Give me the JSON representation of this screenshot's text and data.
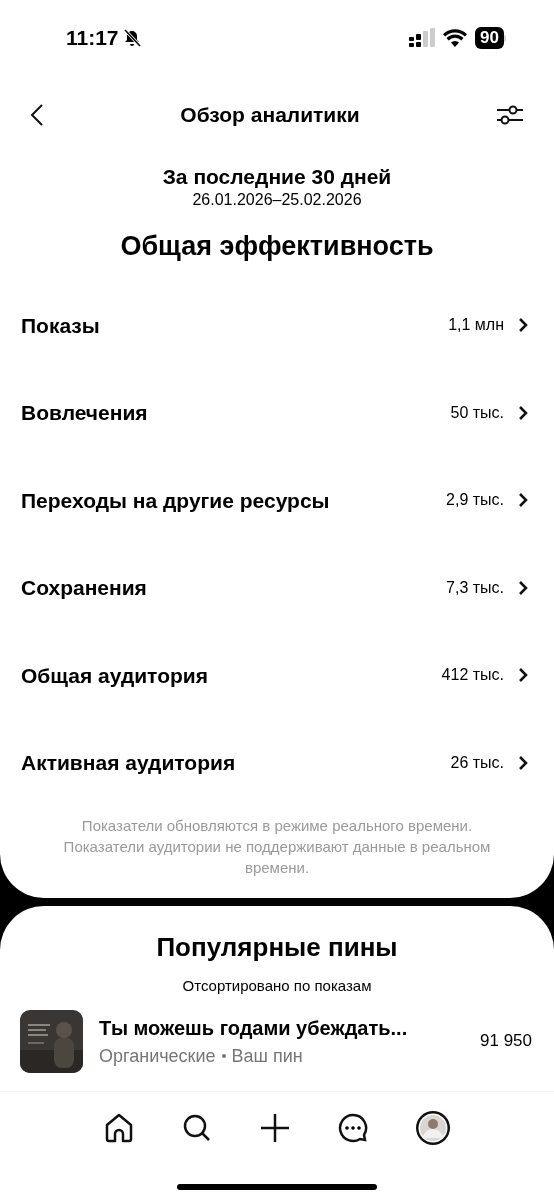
{
  "status_bar": {
    "time": "11:17",
    "silent": true,
    "battery": "90"
  },
  "header": {
    "title": "Обзор аналитики"
  },
  "period": {
    "title": "За последние 30 дней",
    "dates": "26.01.2026–25.02.2026"
  },
  "overall": {
    "title": "Общая эффективность",
    "metrics": [
      {
        "label": "Показы",
        "value": "1,1 млн"
      },
      {
        "label": "Вовлечения",
        "value": "50 тыс."
      },
      {
        "label": "Переходы на другие ресурсы",
        "value": "2,9 тыс."
      },
      {
        "label": "Сохранения",
        "value": "7,3 тыс."
      },
      {
        "label": "Общая аудитория",
        "value": "412 тыс."
      },
      {
        "label": "Активная аудитория",
        "value": "26 тыс."
      }
    ],
    "note": "Показатели обновляются в режиме реального времени. Показатели аудитории не поддерживают данные в реальном времени."
  },
  "popular_pins": {
    "title": "Популярные пины",
    "subtitle": "Отсортировано по показам",
    "pins": [
      {
        "title": "Ты можешь годами убеждать...",
        "source": "Органические",
        "owner": "Ваш пин",
        "count": "91 950"
      }
    ]
  },
  "bottom_nav": [
    {
      "kind": "home"
    },
    {
      "kind": "search"
    },
    {
      "kind": "create"
    },
    {
      "kind": "messages"
    },
    {
      "kind": "profile"
    }
  ]
}
